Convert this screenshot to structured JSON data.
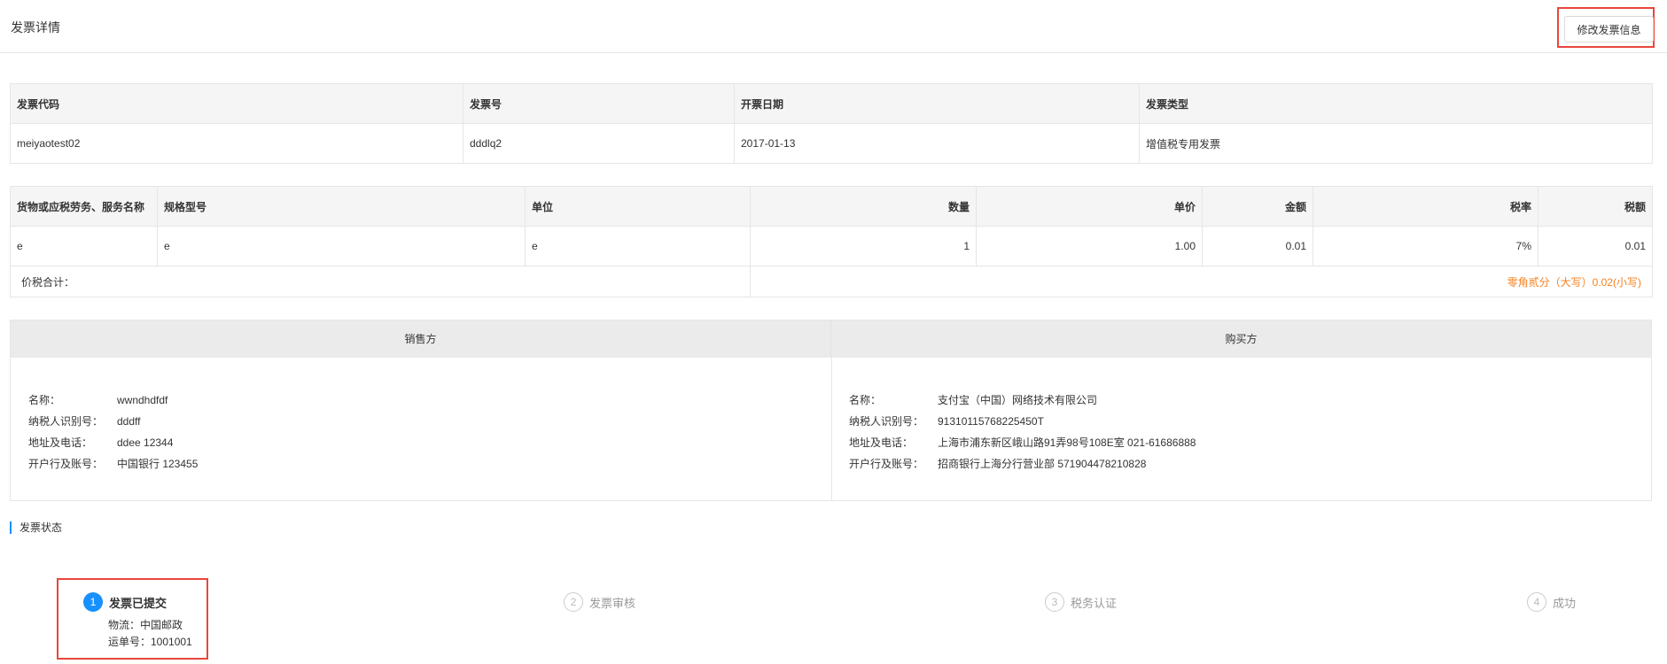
{
  "header": {
    "title": "发票详情",
    "edit_button": "修改发票信息"
  },
  "invoice_info": {
    "headers": [
      "发票代码",
      "发票号",
      "开票日期",
      "发票类型"
    ],
    "row": [
      "meiyaotest02",
      "dddlq2",
      "2017-01-13",
      "增值税专用发票"
    ]
  },
  "goods": {
    "headers": [
      "货物或应税劳务、服务名称",
      "规格型号",
      "单位",
      "数量",
      "单价",
      "金额",
      "税率",
      "税额"
    ],
    "rows": [
      [
        "e",
        "e",
        "e",
        "1",
        "1.00",
        "0.01",
        "7%",
        "0.01"
      ]
    ],
    "total_label": "价税合计：",
    "total_value": "零角贰分（大写）0.02(小写)"
  },
  "seller": {
    "title": "销售方",
    "fields": [
      {
        "label": "名称：",
        "value": "wwndhdfdf"
      },
      {
        "label": "纳税人识别号：",
        "value": "dddff"
      },
      {
        "label": "地址及电话：",
        "value": "ddee 12344"
      },
      {
        "label": "开户行及账号：",
        "value": "中国银行 123455"
      }
    ]
  },
  "buyer": {
    "title": "购买方",
    "fields": [
      {
        "label": "名称：",
        "value": "支付宝（中国）网络技术有限公司"
      },
      {
        "label": "纳税人识别号：",
        "value": "91310115768225450T"
      },
      {
        "label": "地址及电话：",
        "value": "上海市浦东新区峨山路91弄98号108E室 021-61686888"
      },
      {
        "label": "开户行及账号：",
        "value": "招商银行上海分行营业部 571904478210828"
      }
    ]
  },
  "status": {
    "title": "发票状态",
    "steps": [
      {
        "num": "1",
        "label": "发票已提交",
        "active": true
      },
      {
        "num": "2",
        "label": "发票审核",
        "active": false
      },
      {
        "num": "3",
        "label": "税务认证",
        "active": false
      },
      {
        "num": "4",
        "label": "成功",
        "active": false
      }
    ],
    "logistics": "物流：中国邮政",
    "tracking": "运单号：1001001"
  },
  "colors": {
    "accent": "#1890ff",
    "highlight": "#e9463c",
    "amount": "#f5801f",
    "header_bg": "#f5f5f5"
  }
}
